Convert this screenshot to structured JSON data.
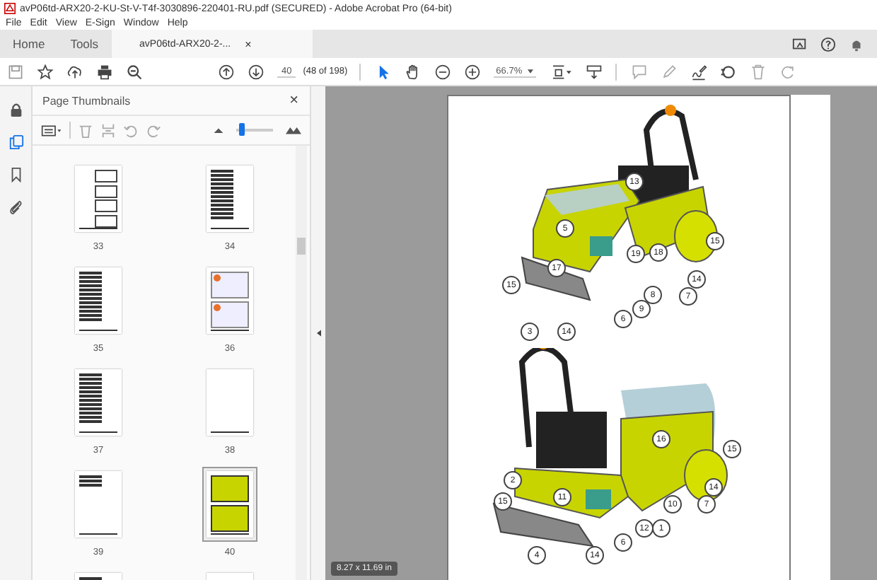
{
  "window": {
    "title": "avP06td-ARX20-2-KU-St-V-T4f-3030896-220401-RU.pdf (SECURED) - Adobe Acrobat Pro (64-bit)"
  },
  "menu": [
    "File",
    "Edit",
    "View",
    "E-Sign",
    "Window",
    "Help"
  ],
  "tabs": [
    {
      "label": "Home",
      "selected": false
    },
    {
      "label": "Tools",
      "selected": false
    },
    {
      "label": "avP06td-ARX20-2-...",
      "selected": true,
      "close": "×"
    }
  ],
  "toolbar": {
    "page_number": "40",
    "page_count": "(48 of 198)",
    "zoom": "66.7%"
  },
  "rail": [
    {
      "kind": "lock",
      "selected": false
    },
    {
      "kind": "pages",
      "selected": true
    },
    {
      "kind": "bookmark",
      "selected": false
    },
    {
      "kind": "attach",
      "selected": false
    }
  ],
  "panel": {
    "title": "Page Thumbnails",
    "close": "×",
    "size_slider": {
      "level": 0.12
    },
    "thumbnails": [
      {
        "label": "33",
        "kind": "figures",
        "selected": false
      },
      {
        "label": "34",
        "kind": "text",
        "selected": false
      },
      {
        "label": "35",
        "kind": "text",
        "selected": false
      },
      {
        "label": "36",
        "kind": "warning",
        "selected": false
      },
      {
        "label": "37",
        "kind": "text",
        "selected": false
      },
      {
        "label": "38",
        "kind": "blank",
        "selected": false
      },
      {
        "label": "39",
        "kind": "short",
        "selected": false
      },
      {
        "label": "40",
        "kind": "machine",
        "selected": true
      },
      {
        "kind": "short",
        "selected": false
      },
      {
        "kind": "blank",
        "selected": false
      }
    ]
  },
  "document": {
    "figures": [
      {
        "callouts": [
          "13",
          "5",
          "19",
          "18",
          "15",
          "15",
          "17",
          "14",
          "8",
          "7",
          "9",
          "6",
          "3",
          "14"
        ]
      },
      {
        "callouts": [
          "16",
          "15",
          "2",
          "15",
          "11",
          "10",
          "7",
          "14",
          "12",
          "1",
          "6",
          "4",
          "14"
        ]
      }
    ]
  },
  "status": {
    "page_size": "8.27 x 11.69 in"
  }
}
